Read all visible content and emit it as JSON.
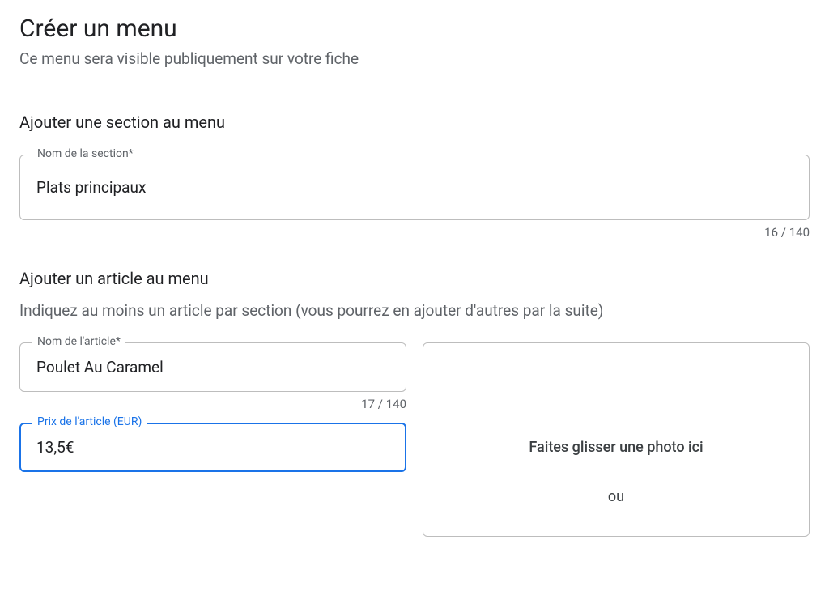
{
  "header": {
    "title": "Créer un menu",
    "subtitle": "Ce menu sera visible publiquement sur votre fiche"
  },
  "section": {
    "heading": "Ajouter une section au menu",
    "name_label": "Nom de la section*",
    "name_value": "Plats principaux",
    "counter": "16 / 140"
  },
  "article": {
    "heading": "Ajouter un article au menu",
    "helper": "Indiquez au moins un article par section (vous pourrez en ajouter d'autres par la suite)",
    "name_label": "Nom de l'article*",
    "name_value": "Poulet Au Caramel",
    "name_counter": "17 / 140",
    "price_label": "Prix de l'article (EUR)",
    "price_value": "13,5€",
    "dropzone": {
      "prompt": "Faites glisser une photo ici",
      "or": "ou"
    }
  }
}
